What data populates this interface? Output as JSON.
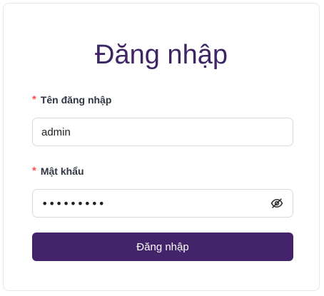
{
  "login": {
    "title": "Đăng nhập",
    "username": {
      "required_mark": "*",
      "label": "Tên đăng nhập",
      "value": "admin"
    },
    "password": {
      "required_mark": "*",
      "label": "Mật khẩu",
      "masked_value": "•••••••••",
      "toggle_icon": "eye-invisible-icon"
    },
    "submit_label": "Đăng nhập"
  },
  "colors": {
    "accent": "#43246a",
    "title": "#3f2564",
    "required": "#ff4d4f",
    "border": "#d9d9d9"
  }
}
